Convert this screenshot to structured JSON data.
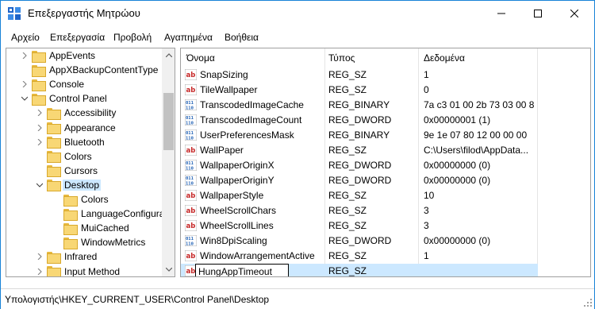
{
  "window": {
    "title": "Επεξεργαστής Μητρώου"
  },
  "menu": [
    "Αρχείο",
    "Επεξεργασία",
    "Προβολή",
    "Αγαπημένα",
    "Βοήθεια"
  ],
  "tree": [
    {
      "label": "AppEvents",
      "level": 1,
      "expander": "right",
      "selected": false
    },
    {
      "label": "AppXBackupContentType",
      "level": 1,
      "expander": "none",
      "selected": false
    },
    {
      "label": "Console",
      "level": 1,
      "expander": "right",
      "selected": false
    },
    {
      "label": "Control Panel",
      "level": 1,
      "expander": "down",
      "selected": false
    },
    {
      "label": "Accessibility",
      "level": 2,
      "expander": "right",
      "selected": false
    },
    {
      "label": "Appearance",
      "level": 2,
      "expander": "right",
      "selected": false
    },
    {
      "label": "Bluetooth",
      "level": 2,
      "expander": "right",
      "selected": false
    },
    {
      "label": "Colors",
      "level": 2,
      "expander": "none",
      "selected": false
    },
    {
      "label": "Cursors",
      "level": 2,
      "expander": "none",
      "selected": false
    },
    {
      "label": "Desktop",
      "level": 2,
      "expander": "down",
      "selected": true
    },
    {
      "label": "Colors",
      "level": 3,
      "expander": "none",
      "selected": false
    },
    {
      "label": "LanguageConfigura",
      "level": 3,
      "expander": "none",
      "selected": false
    },
    {
      "label": "MuiCached",
      "level": 3,
      "expander": "none",
      "selected": false
    },
    {
      "label": "WindowMetrics",
      "level": 3,
      "expander": "none",
      "selected": false
    },
    {
      "label": "Infrared",
      "level": 2,
      "expander": "right",
      "selected": false
    },
    {
      "label": "Input Method",
      "level": 2,
      "expander": "right",
      "selected": false
    }
  ],
  "columns": {
    "name": "Όνομα",
    "type": "Τύπος",
    "data": "Δεδομένα"
  },
  "values": [
    {
      "icon": "string-value-icon",
      "name": "SnapSizing",
      "type": "REG_SZ",
      "data": "1"
    },
    {
      "icon": "string-value-icon",
      "name": "TileWallpaper",
      "type": "REG_SZ",
      "data": "0"
    },
    {
      "icon": "binary-value-icon",
      "name": "TranscodedImageCache",
      "type": "REG_BINARY",
      "data": "7a c3 01 00 2b 73 03 00 8..."
    },
    {
      "icon": "binary-value-icon",
      "name": "TranscodedImageCount",
      "type": "REG_DWORD",
      "data": "0x00000001 (1)"
    },
    {
      "icon": "binary-value-icon",
      "name": "UserPreferencesMask",
      "type": "REG_BINARY",
      "data": "9e 1e 07 80 12 00 00 00"
    },
    {
      "icon": "string-value-icon",
      "name": "WallPaper",
      "type": "REG_SZ",
      "data": "C:\\Users\\filod\\AppData..."
    },
    {
      "icon": "binary-value-icon",
      "name": "WallpaperOriginX",
      "type": "REG_DWORD",
      "data": "0x00000000 (0)"
    },
    {
      "icon": "binary-value-icon",
      "name": "WallpaperOriginY",
      "type": "REG_DWORD",
      "data": "0x00000000 (0)"
    },
    {
      "icon": "string-value-icon",
      "name": "WallpaperStyle",
      "type": "REG_SZ",
      "data": "10"
    },
    {
      "icon": "string-value-icon",
      "name": "WheelScrollChars",
      "type": "REG_SZ",
      "data": "3"
    },
    {
      "icon": "string-value-icon",
      "name": "WheelScrollLines",
      "type": "REG_SZ",
      "data": "3"
    },
    {
      "icon": "binary-value-icon",
      "name": "Win8DpiScaling",
      "type": "REG_DWORD",
      "data": "0x00000000 (0)"
    },
    {
      "icon": "string-value-icon",
      "name": "WindowArrangementActive",
      "type": "REG_SZ",
      "data": "1"
    }
  ],
  "new_value": {
    "icon": "string-value-icon",
    "name": "HungAppTimeout",
    "type": "REG_SZ",
    "data": ""
  },
  "status": {
    "path": "Υπολογιστής\\HKEY_CURRENT_USER\\Control Panel\\Desktop"
  },
  "colors": {
    "selection": "#cce8ff",
    "accent_border": "#1883d7",
    "folder": "#f8d775"
  }
}
